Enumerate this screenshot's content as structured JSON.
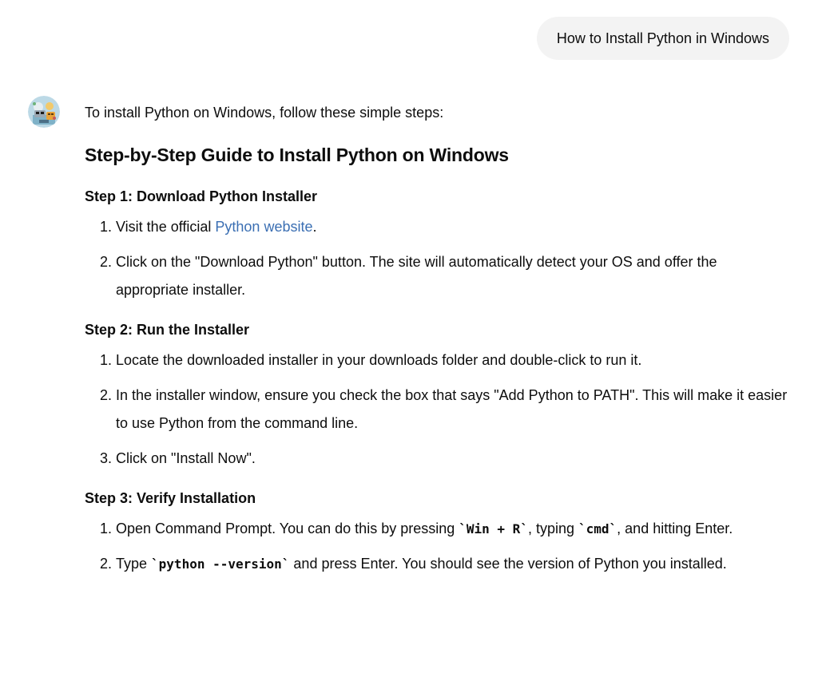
{
  "user_message": "How to Install Python in Windows",
  "assistant": {
    "intro": "To install Python on Windows, follow these simple steps:",
    "title": "Step-by-Step Guide to Install Python on Windows",
    "step1": {
      "heading": "Step 1: Download Python Installer",
      "item1_before": "Visit the official ",
      "item1_link": "Python website",
      "item1_after": ".",
      "item2": "Click on the \"Download Python\" button. The site will automatically detect your OS and offer the appropriate installer."
    },
    "step2": {
      "heading": "Step 2: Run the Installer",
      "item1": "Locate the downloaded installer in your downloads folder and double-click to run it.",
      "item2": "In the installer window, ensure you check the box that says \"Add Python to PATH\". This will make it easier to use Python from the command line.",
      "item3": "Click on \"Install Now\"."
    },
    "step3": {
      "heading": "Step 3: Verify Installation",
      "item1_part1": "Open Command Prompt. You can do this by pressing ",
      "item1_code1": "`Win + R`",
      "item1_part2": ", typing ",
      "item1_code2": "`cmd`",
      "item1_part3": ", and hitting Enter.",
      "item2_part1": "Type ",
      "item2_code": "`python --version`",
      "item2_part2": " and press Enter. You should see the version of Python you installed."
    }
  },
  "colors": {
    "user_bubble_bg": "#f3f3f3",
    "link": "#3b6fb3",
    "text": "#0d0d0d"
  }
}
